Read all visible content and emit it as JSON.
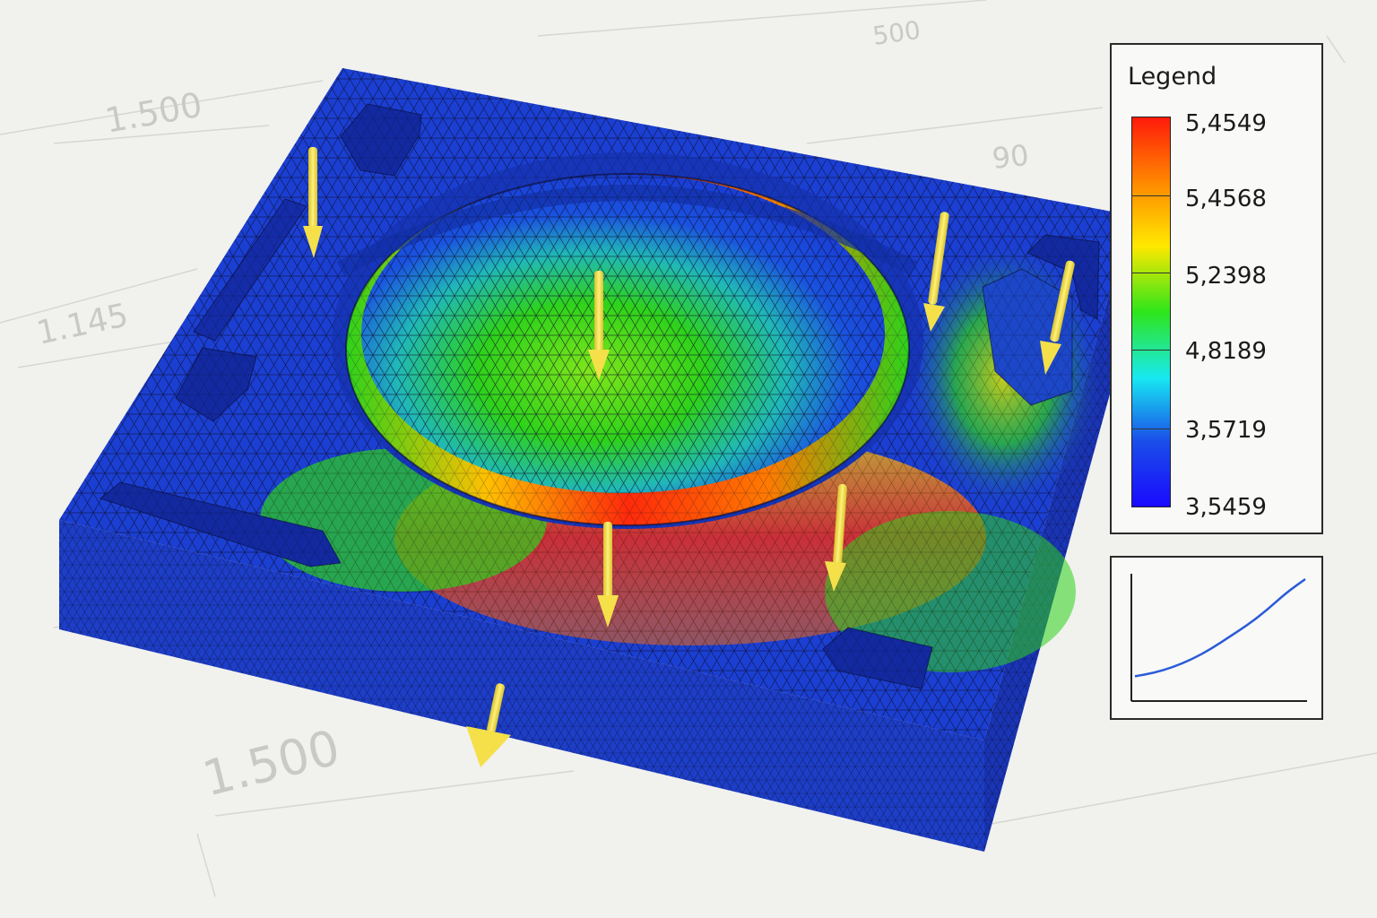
{
  "background_dimensions": [
    "1.500",
    "500",
    "90",
    "1.145",
    "1.500"
  ],
  "legend": {
    "title": "Legend",
    "labels": [
      "5,4549",
      "5,4568",
      "5,2398",
      "4,8189",
      "3,5719",
      "3,5459"
    ],
    "colors": [
      "#ff1a0a",
      "#ff8a00",
      "#ffe800",
      "#2ee61a",
      "#18e8f2",
      "#1a4fe8",
      "#1a0aff"
    ]
  },
  "chart_data": {
    "type": "line",
    "title": "",
    "xlabel": "",
    "ylabel": "",
    "series": [
      {
        "values": [
          0.14,
          0.17,
          0.22,
          0.29,
          0.38,
          0.49,
          0.6,
          0.73,
          0.88,
          1.0
        ]
      }
    ]
  },
  "colors": {
    "mesh_blue": "#1b3fd2",
    "load_arrow": "#f5e04a",
    "paper": "#f1f1ee"
  }
}
